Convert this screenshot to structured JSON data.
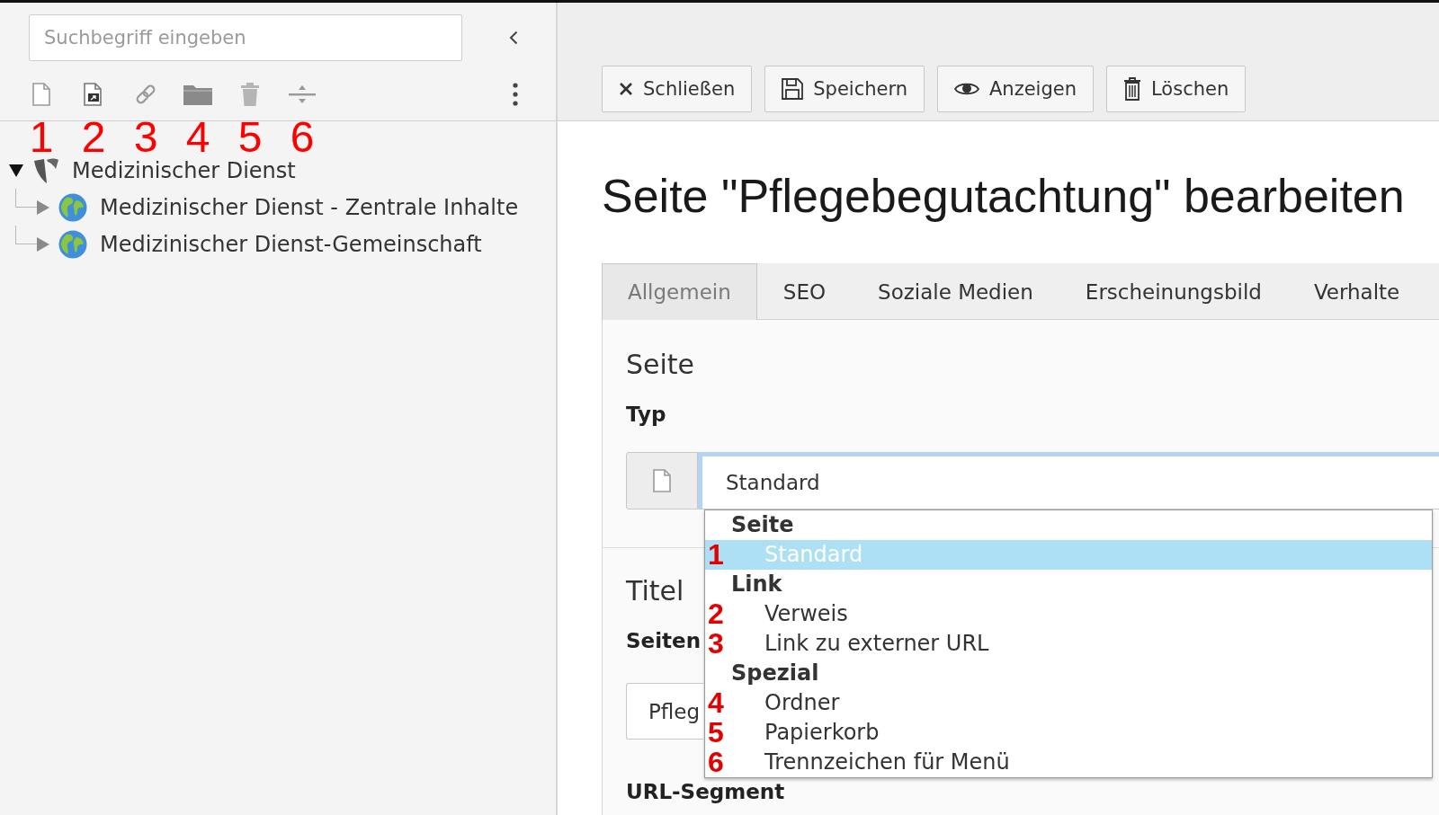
{
  "page_tree": {
    "search": {
      "placeholder": "Suchbegriff eingeben"
    },
    "toolbar": [
      {
        "kind": "page",
        "annotation": "1"
      },
      {
        "kind": "shortcut",
        "annotation": "2"
      },
      {
        "kind": "link",
        "annotation": "3"
      },
      {
        "kind": "folder",
        "annotation": "4"
      },
      {
        "kind": "recycler",
        "annotation": "5"
      },
      {
        "kind": "separator",
        "annotation": "6"
      }
    ],
    "tree": [
      {
        "kind": "root",
        "label": "Medizinischer Dienst",
        "expanded": true,
        "children": [
          {
            "kind": "site",
            "label": "Medizinischer Dienst - Zentrale Inhalte",
            "expanded": false
          },
          {
            "kind": "site",
            "label": "Medizinischer Dienst-Gemeinschaft",
            "expanded": false
          }
        ]
      }
    ]
  },
  "doc_header": {
    "buttons": [
      {
        "kind": "close",
        "label": "Schließen"
      },
      {
        "kind": "save",
        "label": "Speichern"
      },
      {
        "kind": "view",
        "label": "Anzeigen"
      },
      {
        "kind": "delete",
        "label": "Löschen"
      }
    ]
  },
  "heading": "Seite \"Pflegebegutachtung\" bearbeiten",
  "tabs": [
    {
      "label": "Allgemein",
      "selected": true
    },
    {
      "label": "SEO",
      "selected": false
    },
    {
      "label": "Soziale Medien",
      "selected": false
    },
    {
      "label": "Erscheinungsbild",
      "selected": false
    },
    {
      "label": "Verhalte",
      "selected": false
    }
  ],
  "form": {
    "sections": [
      {
        "title": "Seite",
        "fields": [
          {
            "kind": "select",
            "label": "Typ",
            "value": "Standard",
            "open": true,
            "groups": [
              {
                "label": "Seite",
                "options": [
                  {
                    "label": "Standard",
                    "selected": true,
                    "annotation": "1"
                  }
                ]
              },
              {
                "label": "Link",
                "options": [
                  {
                    "label": "Verweis",
                    "selected": false,
                    "annotation": "2"
                  },
                  {
                    "label": "Link zu externer URL",
                    "selected": false,
                    "annotation": "3"
                  }
                ]
              },
              {
                "label": "Spezial",
                "options": [
                  {
                    "label": "Ordner",
                    "selected": false,
                    "annotation": "4"
                  },
                  {
                    "label": "Papierkorb",
                    "selected": false,
                    "annotation": "5"
                  },
                  {
                    "label": "Trennzeichen für Menü",
                    "selected": false,
                    "annotation": "6"
                  }
                ]
              }
            ]
          }
        ]
      },
      {
        "title": "Titel",
        "fields": [
          {
            "kind": "text",
            "label": "Seiten",
            "value": "Pfleg"
          },
          {
            "kind": "text",
            "label": "URL-Segment"
          }
        ]
      }
    ]
  }
}
